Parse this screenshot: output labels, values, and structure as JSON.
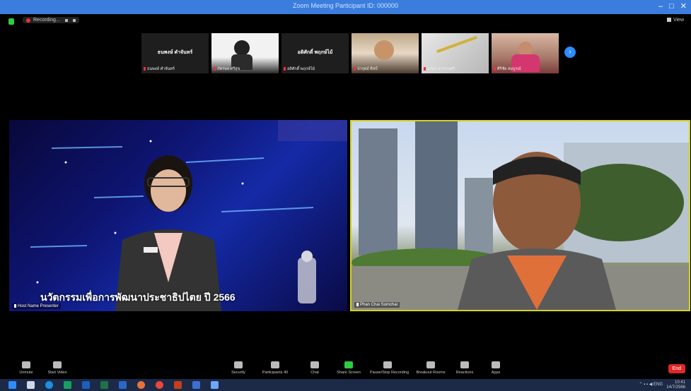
{
  "window": {
    "title": "Zoom Meeting Participant ID: 000000"
  },
  "topbar": {
    "recording_label": "Recording..."
  },
  "participants": [
    {
      "name": "ธนพงษ์ คำจันทร์",
      "label": "ธนพงษ์ คำจันทร์"
    },
    {
      "name": "",
      "label": "ภัทรพล ศรีสุข"
    },
    {
      "name": "อดิศักดิ์ พฤกษ์ไม้",
      "label": "อดิศักดิ์ พฤกษ์ไม้"
    },
    {
      "name": "",
      "label": "ปวรุตม์ ศิลป์"
    },
    {
      "name": "",
      "label": "นภัสร สุวรรณศรี"
    },
    {
      "name": "",
      "label": "ศิริชัย สมบูรณ์"
    }
  ],
  "main_videos": [
    {
      "name": "Host Name Presenter",
      "banner": "นวัตกรรมเพื่อการพัฒนาประชาธิปไตย ปี 2566"
    },
    {
      "name": "Phan Chai Somchai"
    }
  ],
  "toolbar": {
    "unmute": "Unmute",
    "start_video": "Start Video",
    "security": "Security",
    "participants": "Participants",
    "participants_count": "40",
    "chat": "Chat",
    "share_screen": "Share Screen",
    "pause_recording": "Pause/Stop Recording",
    "breakout": "Breakout Rooms",
    "reactions": "Reactions",
    "apps": "Apps",
    "end": "End"
  },
  "clock": {
    "time": "10:41",
    "date": "14/7/2566"
  }
}
